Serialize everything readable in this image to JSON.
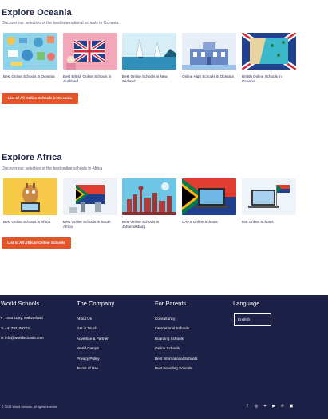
{
  "oceania": {
    "title": "Explore Oceania",
    "subtitle": "Discover our selection of the best international schools in Oceania.",
    "cards": [
      {
        "caption": "Best Online Schools in Oceania"
      },
      {
        "caption": "Best British Online Schools in Auckland"
      },
      {
        "caption": "Best Online Schools in New Zealand"
      },
      {
        "caption": "Online High Schools in Oceania"
      },
      {
        "caption": "British Online Schools in Oceania"
      }
    ],
    "cta": "List of All Online Schools in Oceania"
  },
  "africa": {
    "title": "Explore Africa",
    "subtitle": "Discover our selection of the best online schools in Africa",
    "cards": [
      {
        "caption": "Best Online Schools in Africa"
      },
      {
        "caption": "Best Online Schools in South Africa"
      },
      {
        "caption": "Best Online Schools in Johannesburg"
      },
      {
        "caption": "CAPS Online Schools"
      },
      {
        "caption": "IEB Online Schools"
      }
    ],
    "cta": "List of All African Online Schools"
  },
  "footer": {
    "brand": {
      "heading": "World Schools",
      "address": "7093 Lutry, Switzerland",
      "phone": "+41792190222",
      "email": "info@worldschools.com"
    },
    "company": {
      "heading": "The Company",
      "links": [
        "About Us",
        "Get in Touch",
        "Advertise & Partner",
        "World Camps",
        "Privacy Policy",
        "Terms of Use"
      ]
    },
    "parents": {
      "heading": "For Parents",
      "links": [
        "Consultancy",
        "International Schools",
        "Boarding Schools",
        "Online Schools",
        "Best International Schools",
        "Best Boarding Schools"
      ]
    },
    "language": {
      "heading": "Language",
      "selected": "English"
    },
    "copyright": "© 2023 World Schools. All rights reserved",
    "socials": [
      "facebook-icon",
      "instagram-icon",
      "twitter-icon",
      "youtube-icon",
      "pinterest-icon",
      "linkedin-icon"
    ]
  },
  "colors": {
    "accent": "#e0552a",
    "footer_bg": "#1e2147",
    "heading": "#1b2146"
  }
}
